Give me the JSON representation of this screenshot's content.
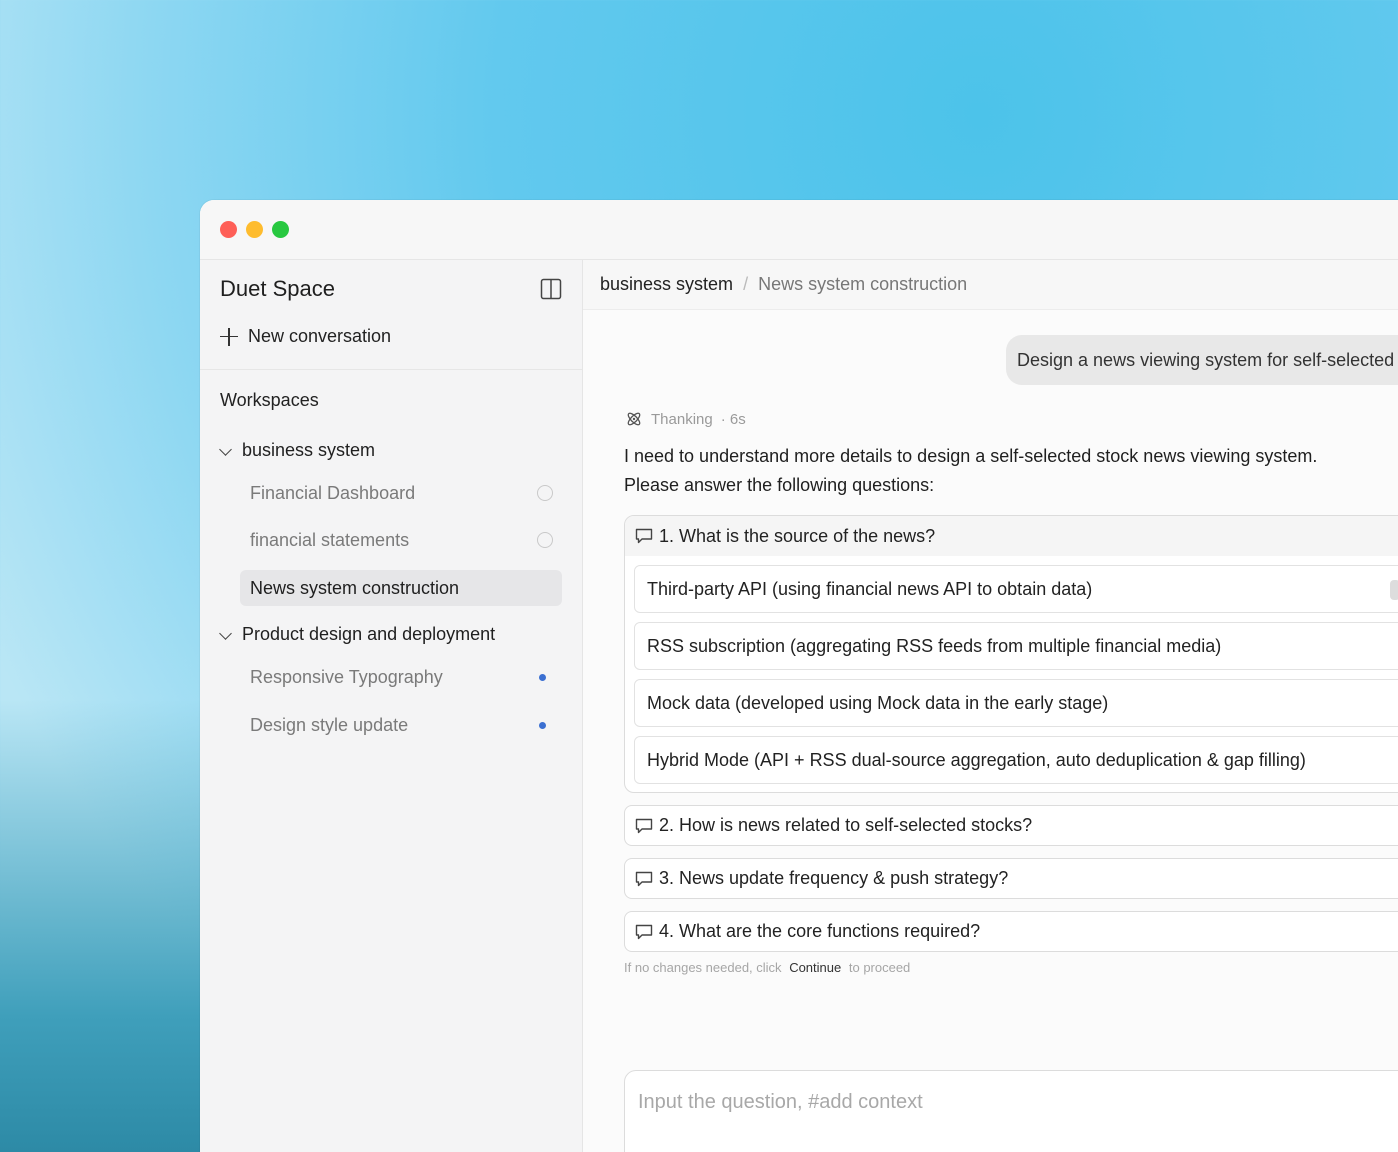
{
  "sidebar": {
    "app_name": "Duet Space",
    "new_conversation": "New conversation",
    "workspaces_title": "Workspaces",
    "groups": [
      {
        "label": "business system",
        "items": [
          {
            "label": "Financial Dashboard"
          },
          {
            "label": "financial statements"
          },
          {
            "label": "News system construction"
          }
        ]
      },
      {
        "label": "Product design and deployment",
        "items": [
          {
            "label": "Responsive Typography"
          },
          {
            "label": "Design style update"
          }
        ]
      }
    ]
  },
  "breadcrumb": {
    "workspace": "business system",
    "separator": "/",
    "current": "News system construction"
  },
  "chat": {
    "user_message": "Design a news viewing system for self-selected stocks",
    "thinking_label": "Thanking",
    "thinking_time": "· 6s",
    "answer": "I need to understand more details to design a self-selected stock news viewing system. Please answer the following questions:",
    "questions": [
      {
        "label": "1. What is the source of the news?",
        "options": [
          "Third-party API (using financial news API to obtain data)",
          "RSS subscription (aggregating RSS feeds from multiple financial media)",
          "Mock data (developed using Mock data in the early stage)",
          "Hybrid Mode (API + RSS dual-source aggregation, auto deduplication & gap filling)"
        ]
      },
      {
        "label": "2. How is news related to self-selected stocks?"
      },
      {
        "label": "3. News update frequency & push strategy?"
      },
      {
        "label": "4. What are the core functions required?"
      }
    ],
    "hint_prefix": "If no changes needed, click",
    "hint_action": "Continue",
    "hint_suffix": "to proceed"
  },
  "input": {
    "placeholder": "Input the question, #add context"
  },
  "colors": {
    "close": "#fe5f57",
    "minimize": "#febc2e",
    "zoom": "#28c840",
    "unread_dot": "#3b6fd1"
  }
}
